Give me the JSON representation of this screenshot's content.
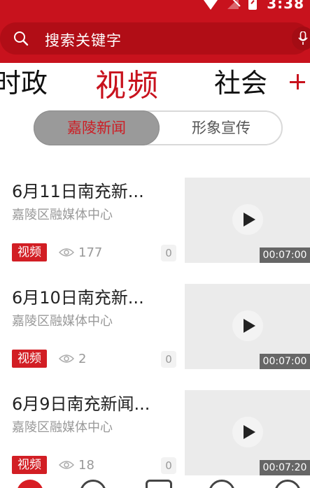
{
  "status_bar": {
    "time": "3:38",
    "icons": [
      "wifi-icon",
      "signal-icon",
      "battery-icon"
    ]
  },
  "search": {
    "placeholder": "搜索关键字",
    "icons": [
      "search-icon",
      "mic-icon"
    ]
  },
  "category_tabs": [
    {
      "label": "时政",
      "active": false
    },
    {
      "label": "视频",
      "active": true
    },
    {
      "label": "社会",
      "active": false
    }
  ],
  "add_tab_label": "+",
  "segment": {
    "options": [
      {
        "label": "嘉陵新闻",
        "active": true
      },
      {
        "label": "形象宣传",
        "active": false
      }
    ]
  },
  "news_items": [
    {
      "title": "6月11日南充新...",
      "source": "嘉陵区融媒体中心",
      "tag": "视频",
      "views": "177",
      "comments": "0",
      "duration": "00:07:00"
    },
    {
      "title": "6月10日南充新...",
      "source": "嘉陵区融媒体中心",
      "tag": "视频",
      "views": "2",
      "comments": "0",
      "duration": "00:07:00"
    },
    {
      "title": "6月9日南充新闻...",
      "source": "嘉陵区融媒体中心",
      "tag": "视频",
      "views": "18",
      "comments": "0",
      "duration": "00:07:20"
    }
  ],
  "bottom_nav": {
    "icons": [
      "home-icon",
      "video-icon",
      "news-icon",
      "audio-icon",
      "profile-icon"
    ]
  },
  "colors": {
    "brand_red": "#c8121d",
    "search_bg": "#b10d16",
    "tag_red": "#d21e24",
    "segment_active_bg": "#9a9a9a"
  }
}
